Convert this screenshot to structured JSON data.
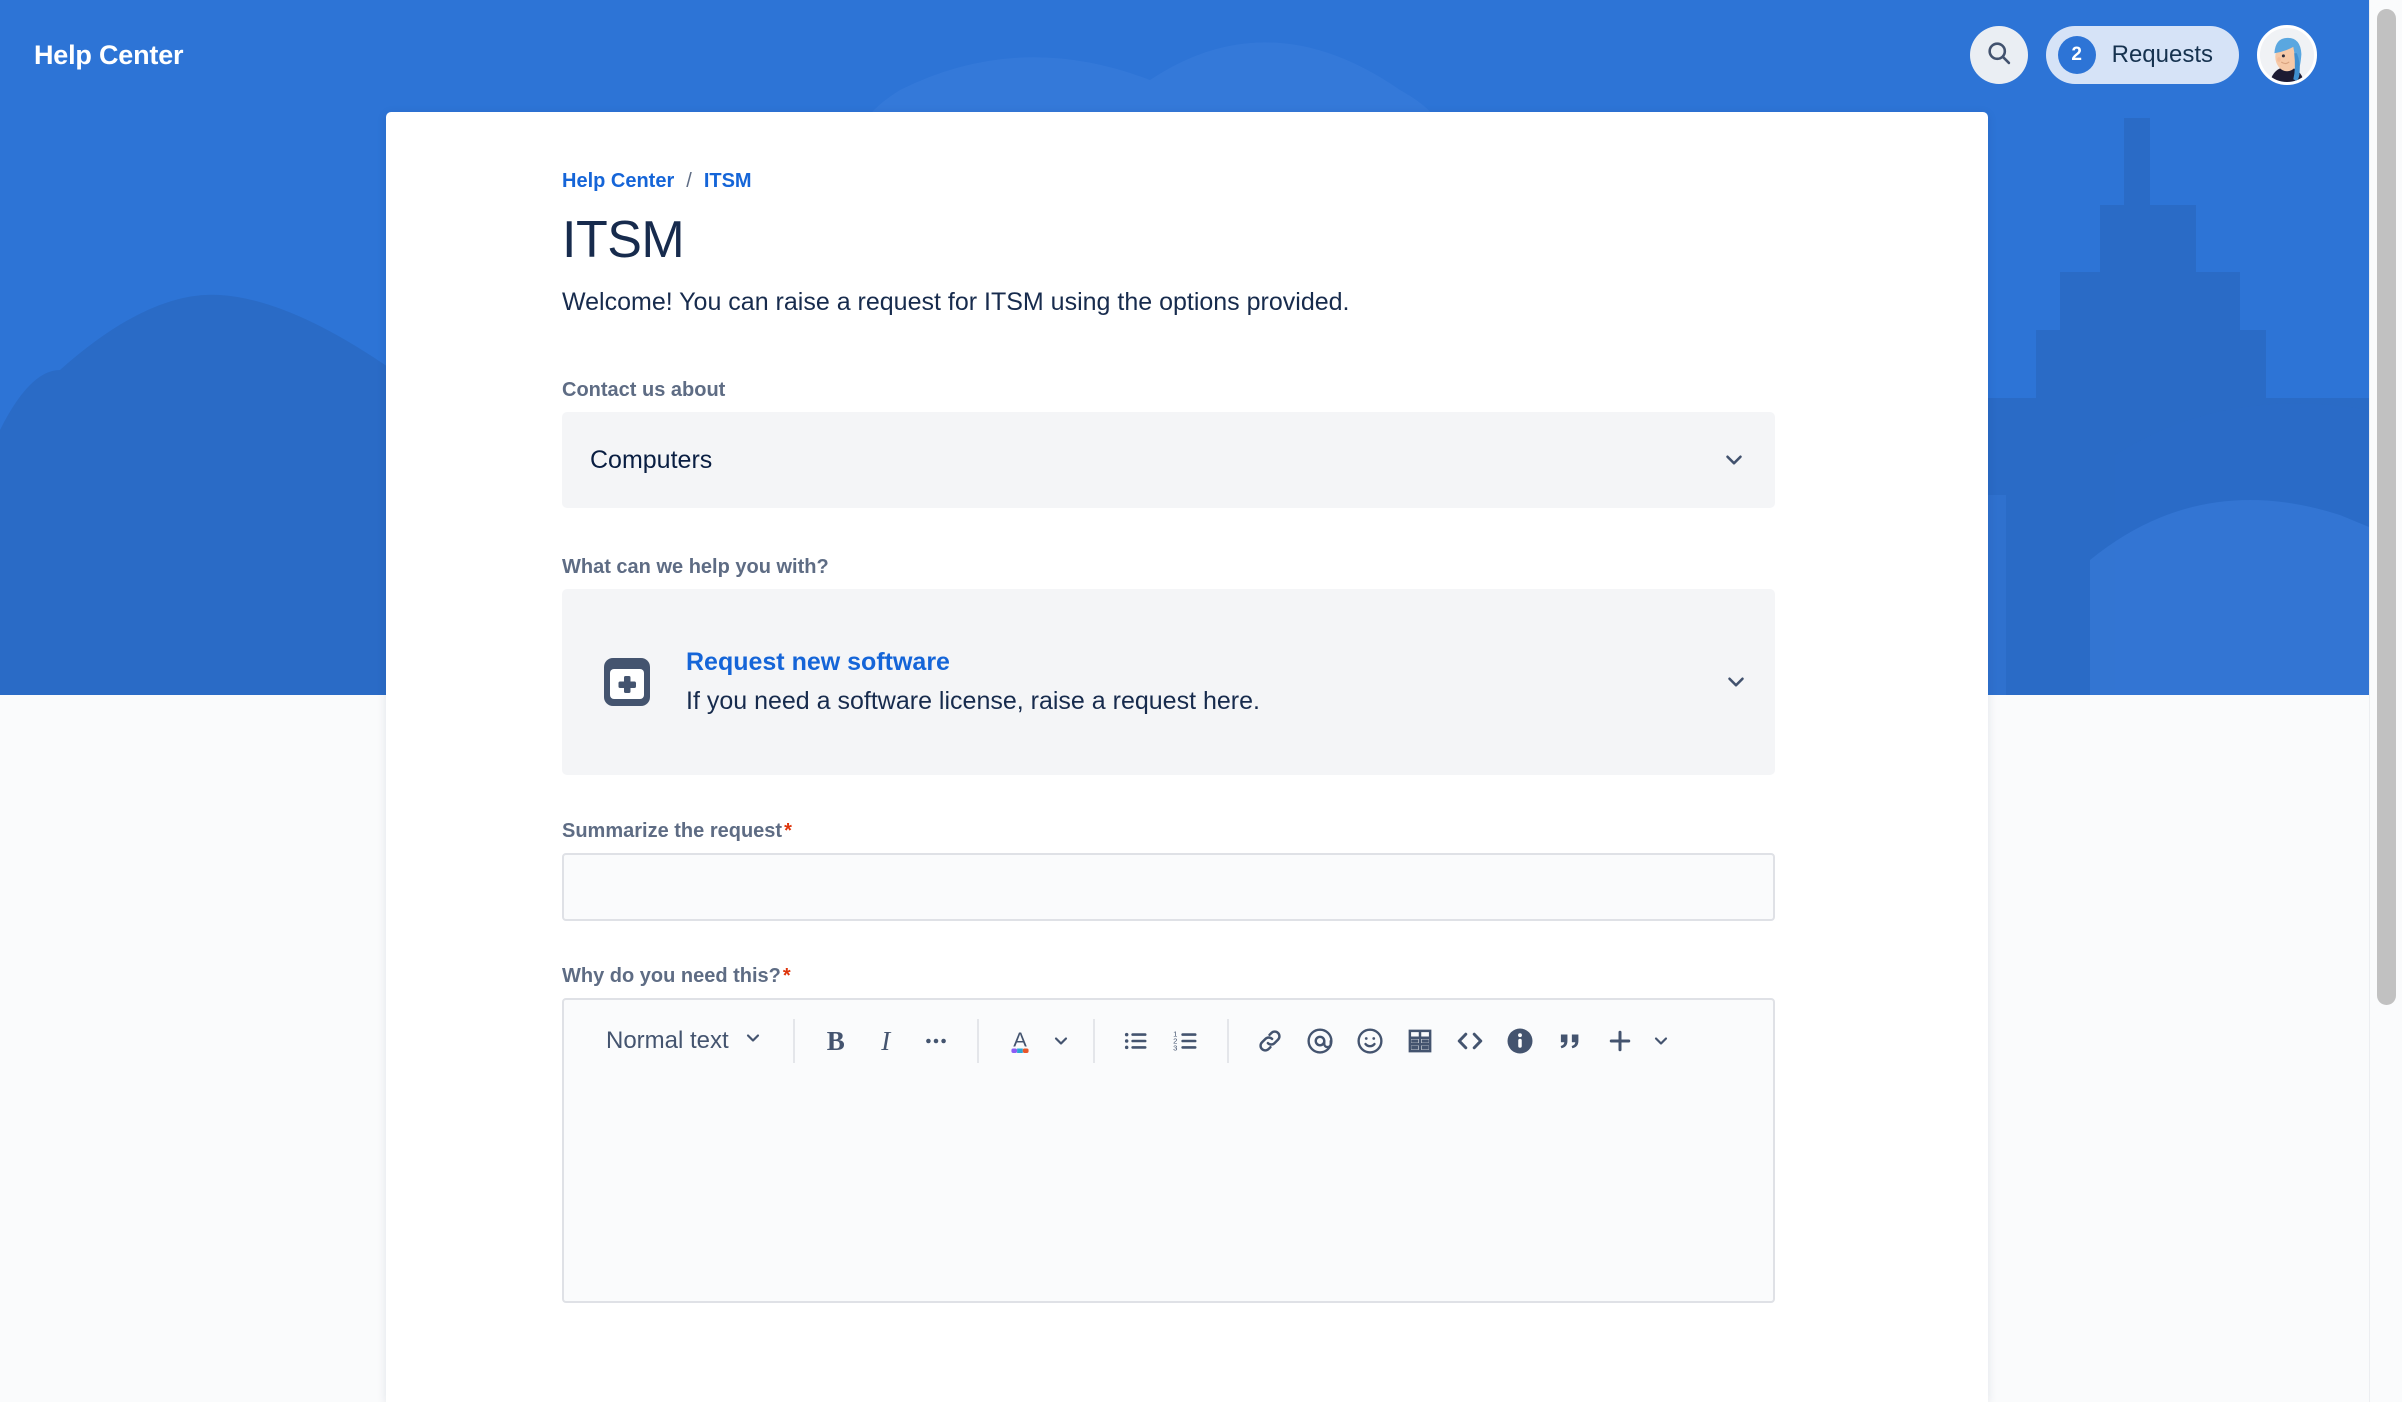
{
  "header": {
    "brand": "Help Center",
    "search_icon": "search-icon",
    "requests": {
      "count": "2",
      "label": "Requests"
    },
    "avatar_icon": "user-avatar"
  },
  "breadcrumb": {
    "items": [
      "Help Center",
      "ITSM"
    ],
    "separator": "/"
  },
  "page": {
    "title": "ITSM",
    "description": "Welcome! You can raise a request for ITSM using the options provided."
  },
  "form": {
    "contact_about": {
      "label": "Contact us about",
      "value": "Computers",
      "chevron_icon": "chevron-down-icon"
    },
    "help_with": {
      "label": "What can we help you with?",
      "request_type": {
        "icon": "add-item-icon",
        "title": "Request new software",
        "description": "If you need a software license, raise a request here."
      },
      "chevron_icon": "chevron-down-icon"
    },
    "summary": {
      "label": "Summarize the request",
      "required_marker": "*",
      "value": "",
      "placeholder": ""
    },
    "why": {
      "label": "Why do you need this?",
      "required_marker": "*",
      "value": "",
      "placeholder": ""
    }
  },
  "editor_toolbar": {
    "style_label": "Normal text",
    "style_chevron": "chevron-down-icon",
    "buttons": [
      {
        "name": "bold-icon",
        "glyph": "B"
      },
      {
        "name": "italic-icon",
        "glyph": "I"
      },
      {
        "name": "more-formatting-icon",
        "glyph": "•••"
      },
      {
        "name": "text-color-icon",
        "glyph": "A"
      },
      {
        "name": "text-color-chevron-icon",
        "glyph": "⌄"
      },
      {
        "name": "bulleted-list-icon",
        "glyph": "list"
      },
      {
        "name": "numbered-list-icon",
        "glyph": "list-ordered"
      },
      {
        "name": "link-icon",
        "glyph": "link"
      },
      {
        "name": "mention-icon",
        "glyph": "@"
      },
      {
        "name": "emoji-icon",
        "glyph": "smiley"
      },
      {
        "name": "table-icon",
        "glyph": "table"
      },
      {
        "name": "code-icon",
        "glyph": "<>"
      },
      {
        "name": "info-panel-icon",
        "glyph": "i"
      },
      {
        "name": "quote-icon",
        "glyph": "”"
      },
      {
        "name": "insert-more-icon",
        "glyph": "+"
      },
      {
        "name": "insert-more-chevron-icon",
        "glyph": "⌄"
      }
    ]
  },
  "colors": {
    "brand_blue": "#2d74d6",
    "link_blue": "#1565d8",
    "badge_blue": "#2d74d6",
    "field_bg": "#f4f5f7",
    "input_bg": "#fafbfc",
    "border": "#dfe1e6",
    "text_dark": "#172b4d",
    "label_gray": "#5e6c84",
    "required_red": "#de350b",
    "icon_slate": "#44546f",
    "page_bg": "#fafbfc"
  },
  "scrollbar": {
    "thumb_color": "#c1c1c1"
  }
}
